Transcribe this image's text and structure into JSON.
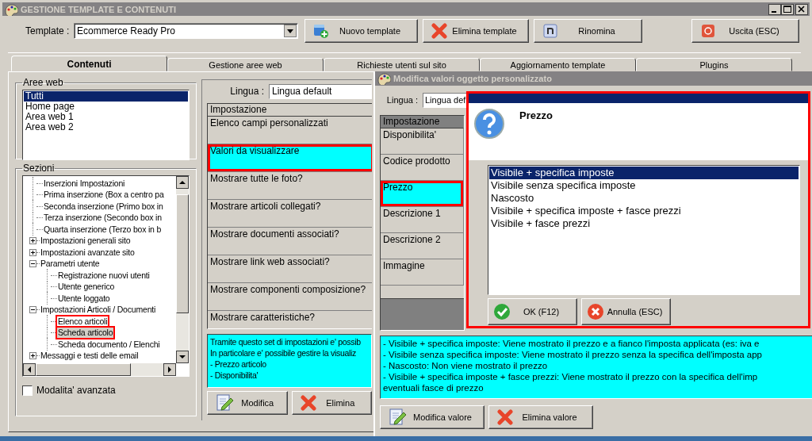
{
  "window": {
    "title": "GESTIONE TEMPLATE E CONTENUTI"
  },
  "toolbar": {
    "template_label": "Template :",
    "template_value": "Ecommerce Ready Pro",
    "buttons": [
      {
        "label": "Nuovo template",
        "kind": "new"
      },
      {
        "label": "Elimina template",
        "kind": "delete"
      },
      {
        "label": "Rinomina",
        "kind": "rename"
      },
      {
        "label": "Uscita (ESC)",
        "kind": "exit"
      }
    ]
  },
  "tabs": [
    {
      "label": "Contenuti",
      "selected": true
    },
    {
      "label": "Gestione aree web",
      "selected": false
    },
    {
      "label": "Richieste utenti sul sito",
      "selected": false
    },
    {
      "label": "Aggiornamento template",
      "selected": false
    },
    {
      "label": "Plugins",
      "selected": false
    }
  ],
  "aree_web": {
    "title": "Aree web",
    "items": [
      {
        "label": "Tutti",
        "selected": true
      },
      {
        "label": "Home page",
        "selected": false
      },
      {
        "label": "Area web 1",
        "selected": false
      },
      {
        "label": "Area web 2",
        "selected": false
      }
    ]
  },
  "sezioni": {
    "title": "Sezioni",
    "tree": [
      {
        "label": "Inserzioni Impostazioni",
        "kind": "leaf",
        "selected": false,
        "highlighted": false
      },
      {
        "label": "Prima inserzione (Box a centro pa",
        "kind": "leaf",
        "selected": false,
        "highlighted": false
      },
      {
        "label": "Seconda inserzione (Primo box in",
        "kind": "leaf",
        "selected": false,
        "highlighted": false
      },
      {
        "label": "Terza inserzione (Secondo box in",
        "kind": "leaf",
        "selected": false,
        "highlighted": false
      },
      {
        "label": "Quarta inserzione (Terzo box in b",
        "kind": "leaf",
        "selected": false,
        "highlighted": false
      },
      {
        "label": "Impostazioni generali sito",
        "kind": "branch",
        "expanded": false,
        "selected": false,
        "highlighted": false
      },
      {
        "label": "Impostazioni avanzate sito",
        "kind": "branch",
        "expanded": false,
        "selected": false,
        "highlighted": false
      },
      {
        "label": "Parametri utente",
        "kind": "branch",
        "expanded": true,
        "selected": false,
        "highlighted": false,
        "children": [
          {
            "label": "Registrazione nuovi utenti",
            "kind": "leaf",
            "selected": false,
            "highlighted": false
          },
          {
            "label": "Utente generico",
            "kind": "leaf",
            "selected": false,
            "highlighted": false
          },
          {
            "label": "Utente loggato",
            "kind": "leaf",
            "selected": false,
            "highlighted": false
          }
        ]
      },
      {
        "label": "Impostazioni Articoli / Documenti",
        "kind": "branch",
        "expanded": true,
        "selected": false,
        "highlighted": false,
        "children": [
          {
            "label": "Elenco articoli",
            "kind": "leaf",
            "selected": false,
            "highlighted": true
          },
          {
            "label": "Scheda articolo",
            "kind": "leaf",
            "selected": true,
            "highlighted": true
          },
          {
            "label": "Scheda documento / Elenchi",
            "kind": "leaf",
            "selected": false,
            "highlighted": false
          }
        ]
      },
      {
        "label": "Messaggi e testi delle email",
        "kind": "branch",
        "expanded": false,
        "selected": false,
        "highlighted": false
      }
    ]
  },
  "advanced_mode": {
    "label": "Modalita' avanzata",
    "checked": false
  },
  "settings_panel": {
    "language_label": "Lingua :",
    "language_value": "Lingua default",
    "column_1": "Impostazione",
    "rows": [
      {
        "label": "Elenco campi personalizzati",
        "selected": false,
        "highlighted": false
      },
      {
        "label": "Valori da visualizzare",
        "selected": true,
        "highlighted": true
      },
      {
        "label": "Mostrare tutte le foto?",
        "selected": false,
        "highlighted": false
      },
      {
        "label": "Mostrare articoli collegati?",
        "selected": false,
        "highlighted": false
      },
      {
        "label": "Mostrare documenti associati?",
        "selected": false,
        "highlighted": false
      },
      {
        "label": "Mostrare link web associati?",
        "selected": false,
        "highlighted": false
      },
      {
        "label": "Mostrare componenti composizione?",
        "selected": false,
        "highlighted": false
      },
      {
        "label": "Mostrare caratteristiche?",
        "selected": false,
        "highlighted": false
      }
    ],
    "description": [
      "Tramite questo set di impostazioni e' possib",
      "In particolare e' possibile gestire la visualiz",
      "- Prezzo articolo",
      "- Disponibilita'"
    ],
    "buttons": [
      {
        "label": "Modifica",
        "kind": "edit"
      },
      {
        "label": "Elimina",
        "kind": "delete"
      }
    ]
  },
  "dialog": {
    "title": "Modifica valori oggetto personalizzato",
    "language_label": "Lingua :",
    "language_value": "Lingua def",
    "column_1": "Impostazione",
    "rows": [
      {
        "label": "Disponibilita'",
        "selected": false,
        "highlighted": false
      },
      {
        "label": "Codice prodotto",
        "selected": false,
        "highlighted": false
      },
      {
        "label": "Prezzo",
        "selected": true,
        "highlighted": true
      },
      {
        "label": "Descrizione 1",
        "selected": false,
        "highlighted": false
      },
      {
        "label": "Descrizione 2",
        "selected": false,
        "highlighted": false
      },
      {
        "label": "Immagine",
        "selected": false,
        "highlighted": false
      }
    ],
    "description": [
      "- Visibile + specifica imposte: Viene mostrato il prezzo e a fianco l'imposta applicata (es: iva e",
      "- Visibile senza specifica imposte: Viene mostrato il prezzo senza la specifica dell'imposta app",
      "- Nascosto: Non viene mostrato il prezzo",
      "- Visibile + specifica imposte + fasce prezzi: Viene mostrato il prezzo con la specifica dell'imp",
      "eventuali fasce di prezzo"
    ],
    "buttons": [
      {
        "label": "Modifica valore",
        "kind": "edit"
      },
      {
        "label": "Elimina valore",
        "kind": "delete"
      }
    ]
  },
  "message_box": {
    "title": "Prezzo",
    "highlighted": true,
    "options": [
      {
        "label": "Visibile + specifica imposte",
        "selected": true
      },
      {
        "label": "Visibile senza specifica imposte",
        "selected": false
      },
      {
        "label": "Nascosto",
        "selected": false
      },
      {
        "label": "Visibile + specifica imposte + fasce prezzi",
        "selected": false
      },
      {
        "label": "Visibile + fasce prezzi",
        "selected": false
      }
    ],
    "buttons": [
      {
        "label": "OK (F12)",
        "kind": "ok"
      },
      {
        "label": "Annulla (ESC)",
        "kind": "cancel"
      }
    ]
  }
}
